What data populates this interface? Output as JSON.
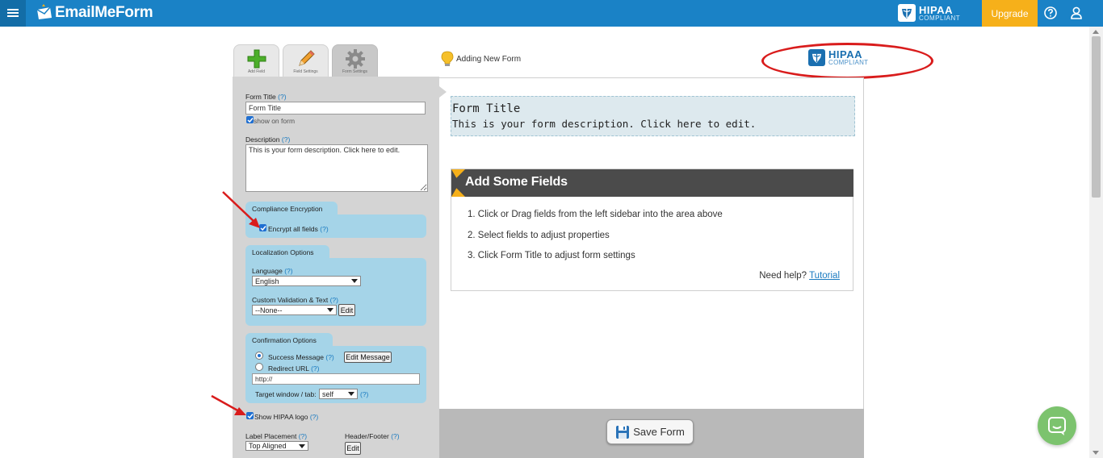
{
  "topbar": {
    "app_name": "EmailMeForm",
    "hipaa_word": "HIPAA",
    "compliant_word": "COMPLIANT",
    "upgrade_label": "Upgrade"
  },
  "tabs": [
    {
      "label": "Add Field"
    },
    {
      "label": "Field Settings"
    },
    {
      "label": "Form Settings"
    }
  ],
  "sidebar": {
    "form_title_label": "Form Title",
    "help_mark": "(?)",
    "form_title_value": "Form Title",
    "show_on_form_label": "show on form",
    "description_label": "Description",
    "description_value": "This is your form description. Click here to edit.",
    "compliance": {
      "heading": "Compliance Encryption",
      "encrypt_label": "Encrypt all fields"
    },
    "localization": {
      "heading": "Localization Options",
      "language_label": "Language",
      "language_value": "English",
      "custom_validation_label": "Custom Validation & Text",
      "custom_validation_value": "--None--",
      "edit_label": "Edit"
    },
    "confirmation": {
      "heading": "Confirmation Options",
      "success_label": "Success Message",
      "edit_message_label": "Edit Message",
      "redirect_label": "Redirect URL",
      "url_value": "http://",
      "target_label": "Target window / tab:",
      "target_value": "self"
    },
    "show_hipaa_label": "Show HIPAA logo",
    "label_placement_label": "Label Placement",
    "label_placement_value": "Top Aligned",
    "header_footer_label": "Header/Footer",
    "header_footer_edit": "Edit"
  },
  "canvas": {
    "tip_text": "Adding New Form",
    "form_title": "Form Title",
    "form_description": "This is your form description. Click here to edit.",
    "fields_heading": "Add Some Fields",
    "steps": [
      "1. Click or Drag fields from the left sidebar into the area above",
      "2. Select fields to adjust properties",
      "3. Click Form Title to adjust form settings"
    ],
    "need_help": "Need help?",
    "tutorial_link": "Tutorial",
    "save_label": "Save Form"
  },
  "colors": {
    "topbar": "#1a82c6",
    "upgrade": "#f6b01a",
    "sidebar": "#d4d4d4",
    "section": "#a5d4e8",
    "annotation": "#d91c1c",
    "chat": "#7cc36e"
  }
}
